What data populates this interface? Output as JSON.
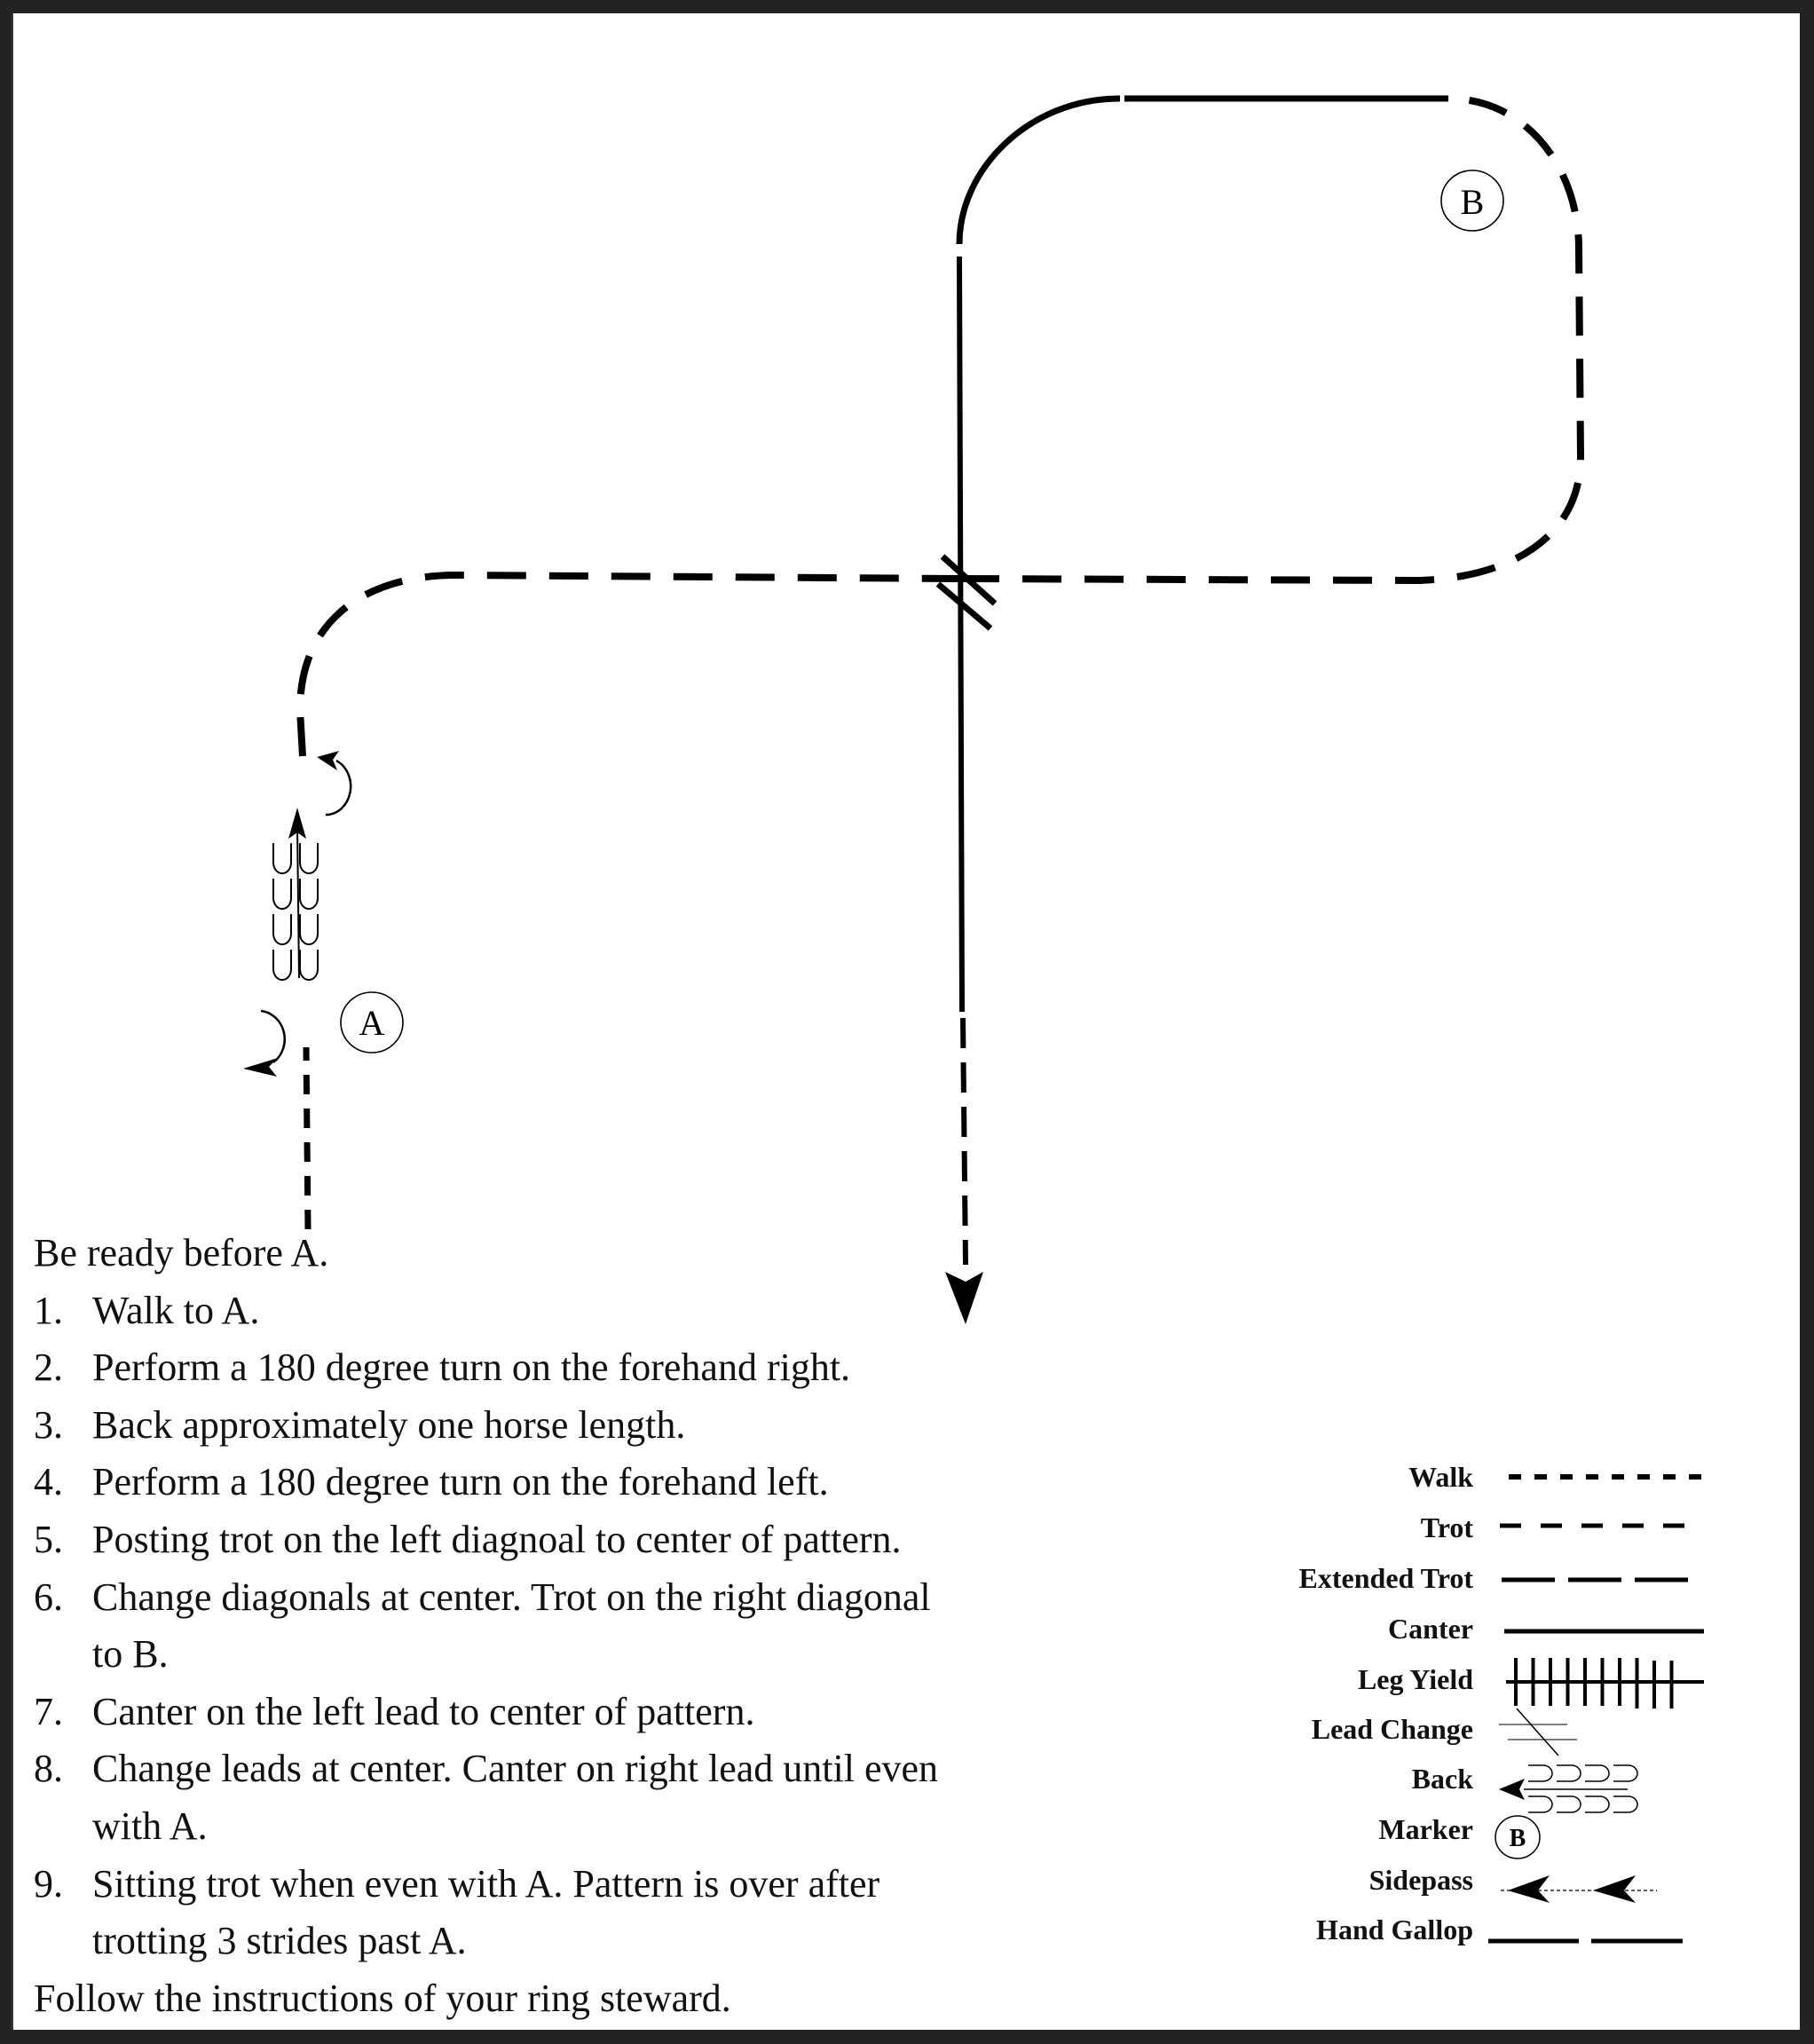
{
  "page": {
    "background_color": "#232323",
    "paper_color": "#ffffff",
    "ink_color": "#000000"
  },
  "markers": [
    {
      "label": "A",
      "role": "start-reference"
    },
    {
      "label": "B",
      "role": "trot-target"
    }
  ],
  "pattern": {
    "segments": [
      {
        "gait": "Walk",
        "description": "Walk up to A"
      },
      {
        "gait": "Turn",
        "description": "180 degree turn on the forehand right"
      },
      {
        "gait": "Back",
        "description": "Back approximately one horse length"
      },
      {
        "gait": "Turn",
        "description": "180 degree turn on the forehand left"
      },
      {
        "gait": "Trot",
        "description": "Posting trot on left diagonal to center"
      },
      {
        "gait": "Lead Change",
        "description": "Change at center"
      },
      {
        "gait": "Trot",
        "description": "Trot on right diagonal to B"
      },
      {
        "gait": "Canter",
        "description": "Canter left lead to center, change, canter right lead"
      },
      {
        "gait": "Trot",
        "description": "Sitting trot past A, finish arrow"
      }
    ]
  },
  "instructions": {
    "intro": "Be ready before A.",
    "steps": [
      {
        "num": "1.",
        "lines": [
          "Walk to A."
        ]
      },
      {
        "num": "2.",
        "lines": [
          "Perform a 180 degree turn on the forehand right."
        ]
      },
      {
        "num": "3.",
        "lines": [
          "Back approximately one horse length."
        ]
      },
      {
        "num": "4.",
        "lines": [
          "Perform a 180 degree turn on the forehand left."
        ]
      },
      {
        "num": "5.",
        "lines": [
          "Posting trot on the left diagnoal to center of  pattern."
        ]
      },
      {
        "num": "6.",
        "lines": [
          "Change diagonals at center.  Trot on the right diagonal",
          "to B."
        ]
      },
      {
        "num": "7.",
        "lines": [
          "Canter on the left lead to center of  pattern."
        ]
      },
      {
        "num": "8.",
        "lines": [
          "Change leads at center.  Canter on right lead until even",
          "with A."
        ]
      },
      {
        "num": "9.",
        "lines": [
          "Sitting trot when even with A.  Pattern is over after",
          "trotting 3 strides past A."
        ]
      }
    ],
    "outro": "Follow the instructions of  your ring steward."
  },
  "legend": {
    "items": [
      {
        "label": "Walk",
        "symbol": "walk-line"
      },
      {
        "label": "Trot",
        "symbol": "trot-line"
      },
      {
        "label": "Extended Trot",
        "symbol": "extended-trot-line"
      },
      {
        "label": "Canter",
        "symbol": "canter-line"
      },
      {
        "label": "Leg Yield",
        "symbol": "leg-yield-line"
      },
      {
        "label": "Lead Change",
        "symbol": "lead-change-symbol"
      },
      {
        "label": "Back",
        "symbol": "back-symbol"
      },
      {
        "label": "Marker",
        "symbol": "marker-circle",
        "marker_label": "B"
      },
      {
        "label": "Sidepass",
        "symbol": "sidepass-symbol"
      },
      {
        "label": "Hand Gallop",
        "symbol": "hand-gallop-line"
      }
    ]
  }
}
